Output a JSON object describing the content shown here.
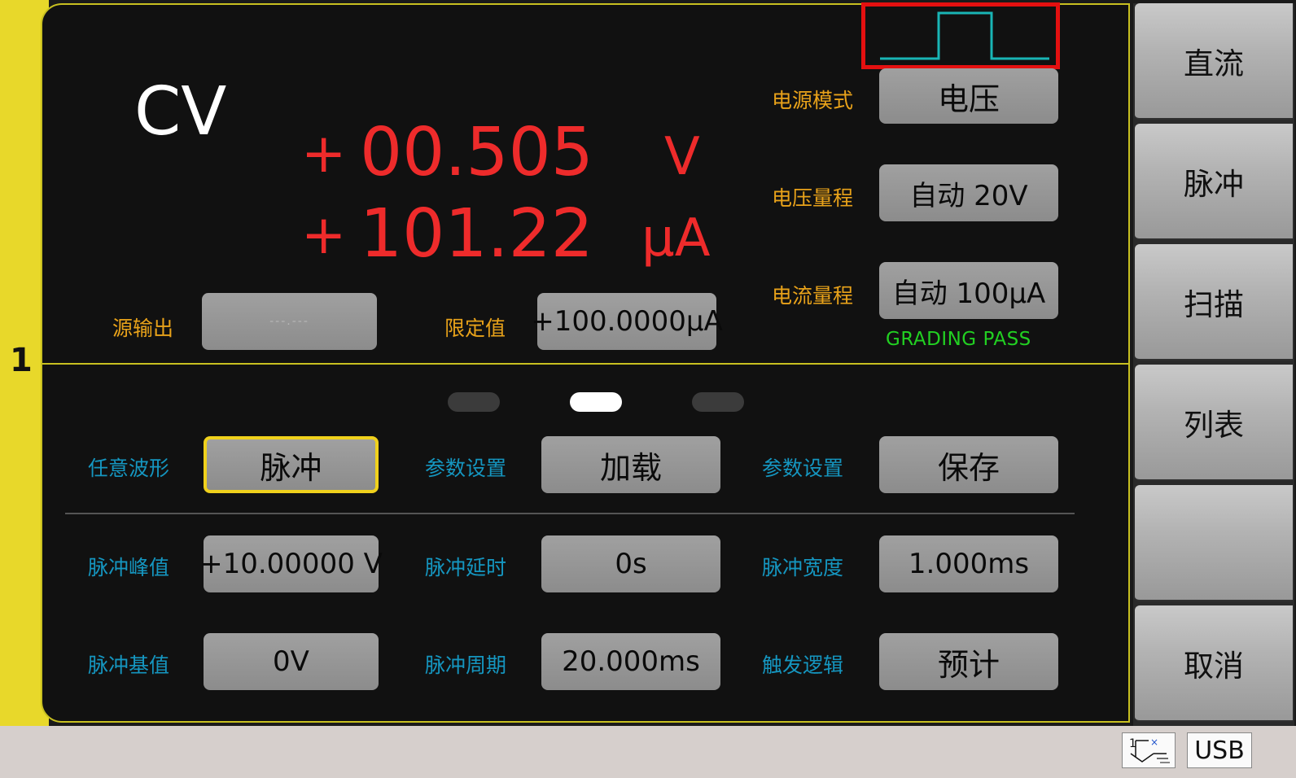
{
  "channel": {
    "number": "1"
  },
  "mode_indicator": "CV",
  "readings": {
    "voltage": {
      "sign": "+",
      "value": "00.505",
      "unit": "V"
    },
    "current": {
      "sign": "+",
      "value": "101.22",
      "unit": "µA"
    }
  },
  "top_panel": {
    "source_output": {
      "label": "源输出",
      "value": "---.---"
    },
    "limit": {
      "label": "限定值",
      "value": "+100.0000µA"
    },
    "power_mode": {
      "label": "电源模式",
      "value": "电压"
    },
    "voltage_range": {
      "label": "电压量程",
      "value": "自动 20V"
    },
    "current_range": {
      "label": "电流量程",
      "value": "自动 100µA"
    },
    "grading": "GRADING PASS"
  },
  "pagination": {
    "pages": 3,
    "active_index": 1
  },
  "bottom_panel": {
    "row1": [
      {
        "label": "任意波形",
        "value": "脉冲"
      },
      {
        "label": "参数设置",
        "value": "加载"
      },
      {
        "label": "参数设置",
        "value": "保存"
      }
    ],
    "row2": [
      {
        "label": "脉冲峰值",
        "value": "+10.00000 V"
      },
      {
        "label": "脉冲延时",
        "value": "0s"
      },
      {
        "label": "脉冲宽度",
        "value": "1.000ms"
      }
    ],
    "row3": [
      {
        "label": "脉冲基值",
        "value": "0V"
      },
      {
        "label": "脉冲周期",
        "value": "20.000ms"
      },
      {
        "label": "触发逻辑",
        "value": "预计"
      }
    ]
  },
  "softkeys": [
    "直流",
    "脉冲",
    "扫描",
    "列表",
    "",
    "取消"
  ],
  "statusbar": {
    "usb_label": "USB",
    "network_icon": "network-icon"
  },
  "colors": {
    "reading": "#ee2b2b",
    "label_orange": "#e8a21a",
    "label_blue": "#1596c0",
    "accent_yellow": "#f0d11c",
    "grading": "#22d022",
    "highlight_box": "#e41010",
    "pulse_trace": "#19b5b5"
  }
}
